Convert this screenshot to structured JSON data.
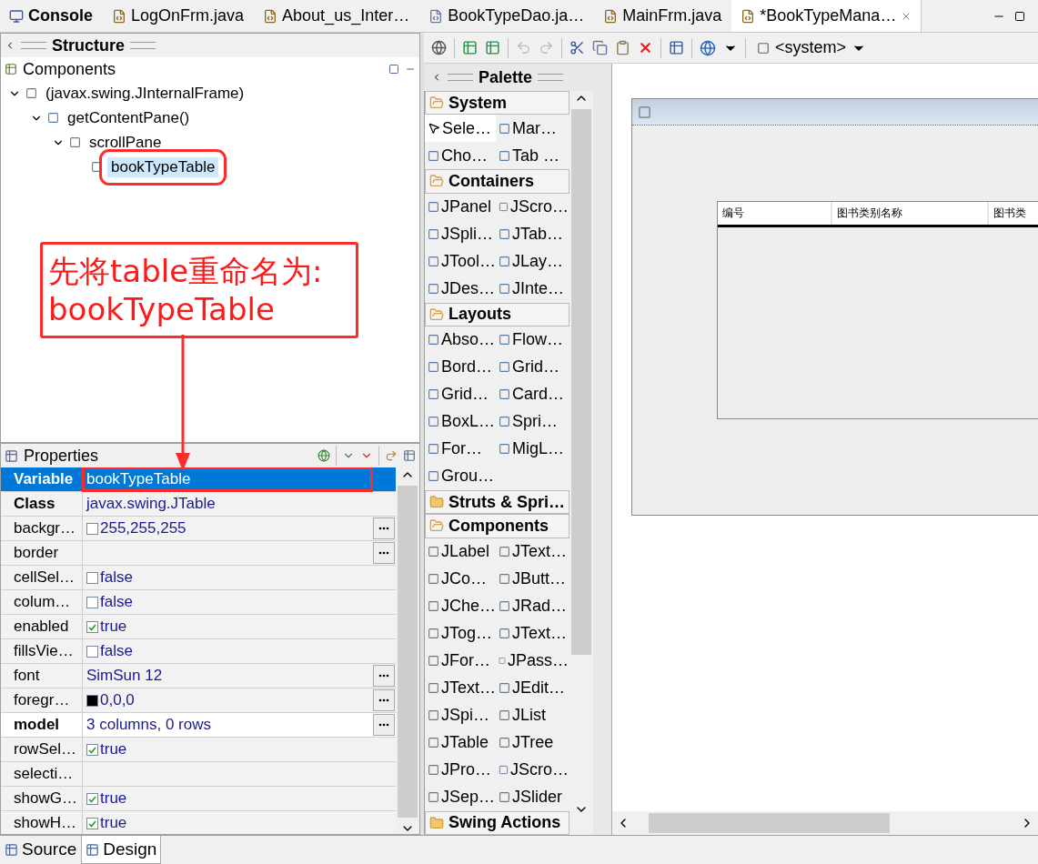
{
  "editor_tabs": [
    {
      "label": "Console",
      "kind": "console",
      "selected": false
    },
    {
      "label": "LogOnFrm.java",
      "kind": "java",
      "selected": false
    },
    {
      "label": "About_us_Inter…",
      "kind": "java",
      "selected": false
    },
    {
      "label": "BookTypeDao.ja…",
      "kind": "class",
      "selected": false
    },
    {
      "label": "MainFrm.java",
      "kind": "java",
      "selected": false
    },
    {
      "label": "*BookTypeMana…",
      "kind": "java",
      "selected": true
    }
  ],
  "structure": {
    "title": "Structure",
    "components_title": "Components",
    "tree": [
      {
        "label": "(javax.swing.JInternalFrame)",
        "expanded": true,
        "selected": false,
        "highlighted": false,
        "children": [
          {
            "label": "getContentPane()",
            "expanded": true,
            "selected": false,
            "highlighted": false,
            "children": [
              {
                "label": "scrollPane",
                "expanded": true,
                "selected": false,
                "highlighted": false,
                "children": [
                  {
                    "label": "bookTypeTable",
                    "selected": true,
                    "highlighted": true
                  }
                ]
              }
            ]
          }
        ]
      }
    ]
  },
  "annotation": {
    "lines": [
      "先将table重命名为:",
      "bookTypeTable"
    ]
  },
  "properties": {
    "title": "Properties",
    "rows": [
      {
        "name": "Variable",
        "value": "bookTypeTable",
        "kind": "text",
        "bold": true,
        "selected": true,
        "highlighted": true,
        "button": false
      },
      {
        "name": "Class",
        "value": "javax.swing.JTable",
        "kind": "text",
        "bold": true,
        "selected": false,
        "highlighted": false,
        "button": false
      },
      {
        "name": "backgr…",
        "value": "255,255,255",
        "kind": "color",
        "color": "#ffffff",
        "bold": false,
        "selected": false,
        "highlighted": false,
        "button": true
      },
      {
        "name": "border",
        "kind": "text",
        "bold": false,
        "selected": false,
        "highlighted": false,
        "button": true
      },
      {
        "name": "cellSel…",
        "value": "false",
        "kind": "check",
        "checked": false,
        "bold": false,
        "selected": false,
        "highlighted": false,
        "button": false
      },
      {
        "name": "colum…",
        "value": "false",
        "kind": "check",
        "checked": false,
        "bold": false,
        "selected": false,
        "highlighted": false,
        "button": false
      },
      {
        "name": "enabled",
        "value": "true",
        "kind": "check",
        "checked": true,
        "bold": false,
        "selected": false,
        "highlighted": false,
        "button": false
      },
      {
        "name": "fillsVie…",
        "value": "false",
        "kind": "check",
        "checked": false,
        "bold": false,
        "selected": false,
        "highlighted": false,
        "button": false
      },
      {
        "name": "font",
        "value": "SimSun 12",
        "kind": "text",
        "bold": false,
        "selected": false,
        "highlighted": false,
        "button": true
      },
      {
        "name": "foregr…",
        "value": "0,0,0",
        "kind": "color",
        "color": "#000000",
        "bold": false,
        "selected": false,
        "highlighted": false,
        "button": true
      },
      {
        "name": "model",
        "value": "3 columns, 0 rows",
        "kind": "text",
        "bold": true,
        "selected": false,
        "highlighted": false,
        "button": true
      },
      {
        "name": "rowSel…",
        "value": "true",
        "kind": "check",
        "checked": true,
        "bold": false,
        "selected": false,
        "highlighted": false,
        "button": false
      },
      {
        "name": "selecti…",
        "kind": "text",
        "bold": false,
        "selected": false,
        "highlighted": false,
        "button": false
      },
      {
        "name": "showG…",
        "value": "true",
        "kind": "check",
        "checked": true,
        "bold": false,
        "selected": false,
        "highlighted": false,
        "button": false
      },
      {
        "name": "showH…",
        "value": "true",
        "kind": "check",
        "checked": true,
        "bold": false,
        "selected": false,
        "highlighted": false,
        "button": false
      }
    ]
  },
  "toolbar": {
    "system": "<system>"
  },
  "palette": {
    "title": "Palette",
    "groups": [
      {
        "name": "System",
        "expanded": true,
        "items": [
          {
            "label": "Sele…",
            "selected": true
          },
          {
            "label": "Mar…",
            "selected": false
          },
          {
            "label": "Cho…",
            "selected": false
          },
          {
            "label": "Tab …",
            "selected": false
          }
        ]
      },
      {
        "name": "Containers",
        "expanded": true,
        "items": [
          {
            "label": "JPanel",
            "selected": false
          },
          {
            "label": "JScro…",
            "selected": false
          },
          {
            "label": "JSpli…",
            "selected": false
          },
          {
            "label": "JTab…",
            "selected": false
          },
          {
            "label": "JTool…",
            "selected": false
          },
          {
            "label": "JLay…",
            "selected": false
          },
          {
            "label": "JDes…",
            "selected": false
          },
          {
            "label": "JInte…",
            "selected": false
          }
        ]
      },
      {
        "name": "Layouts",
        "expanded": true,
        "items": [
          {
            "label": "Abso…",
            "selected": false
          },
          {
            "label": "Flow…",
            "selected": false
          },
          {
            "label": "Bord…",
            "selected": false
          },
          {
            "label": "Grid…",
            "selected": false
          },
          {
            "label": "Grid…",
            "selected": false
          },
          {
            "label": "Card…",
            "selected": false
          },
          {
            "label": "BoxL…",
            "selected": false
          },
          {
            "label": "Spri…",
            "selected": false
          },
          {
            "label": "For…",
            "selected": false
          },
          {
            "label": "MigL…",
            "selected": false
          },
          {
            "label": "Grou…",
            "selected": false
          }
        ]
      },
      {
        "name": "Struts & Spri…",
        "expanded": false
      },
      {
        "name": "Components",
        "expanded": true,
        "items": [
          {
            "label": "JLabel",
            "selected": false
          },
          {
            "label": "JText…",
            "selected": false
          },
          {
            "label": "JCo…",
            "selected": false
          },
          {
            "label": "JButt…",
            "selected": false
          },
          {
            "label": "JChe…",
            "selected": false
          },
          {
            "label": "JRad…",
            "selected": false
          },
          {
            "label": "JTog…",
            "selected": false
          },
          {
            "label": "JText…",
            "selected": false
          },
          {
            "label": "JFor…",
            "selected": false
          },
          {
            "label": "JPass…",
            "selected": false
          },
          {
            "label": "JText…",
            "selected": false
          },
          {
            "label": "JEdit…",
            "selected": false
          },
          {
            "label": "JSpi…",
            "selected": false
          },
          {
            "label": "JList",
            "selected": false
          },
          {
            "label": "JTable",
            "selected": false
          },
          {
            "label": "JTree",
            "selected": false
          },
          {
            "label": "JPro…",
            "selected": false
          },
          {
            "label": "JScro…",
            "selected": false
          },
          {
            "label": "JSep…",
            "selected": false
          },
          {
            "label": "JSlider",
            "selected": false
          }
        ]
      },
      {
        "name": "Swing Actions",
        "expanded": false
      }
    ]
  },
  "designer": {
    "columns": [
      "编号",
      "图书类别名称",
      "图书类"
    ]
  },
  "bottom_tabs": [
    {
      "label": "Source",
      "selected": false
    },
    {
      "label": "Design",
      "selected": true
    }
  ]
}
